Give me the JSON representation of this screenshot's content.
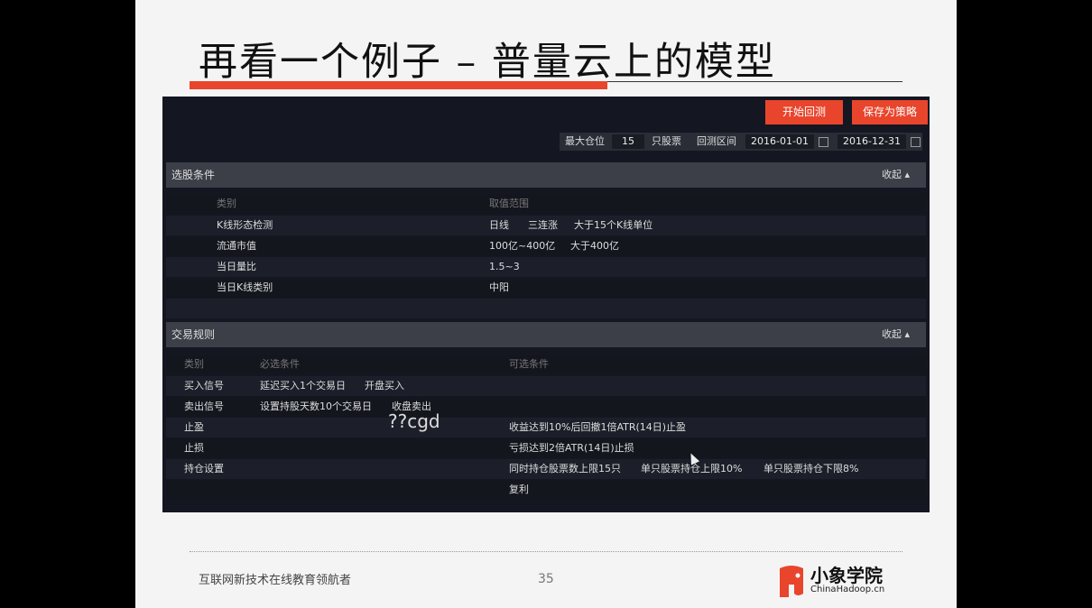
{
  "slide": {
    "title": "再看一个例子 – 普量云上的模型",
    "footer_text": "互联网新技术在线教育领航者",
    "page_number": "35",
    "logo_name": "小象学院",
    "logo_url": "ChinaHadoop.cn"
  },
  "toolbar": {
    "start_backtest": "开始回测",
    "save_strategy": "保存为策略"
  },
  "params": {
    "max_position_label": "最大仓位",
    "max_position_value": "15",
    "max_position_unit": "只股票",
    "period_label": "回测区间",
    "start_date": "2016-01-01",
    "end_date": "2016-12-31"
  },
  "stock_selection": {
    "title": "选股条件",
    "toggle": "收起",
    "headers": [
      "类别",
      "取值范围"
    ],
    "rows": [
      {
        "category": "K线形态检测",
        "values": [
          "日线",
          "三连涨",
          "大于15个K线单位"
        ]
      },
      {
        "category": "流通市值",
        "values": [
          "100亿~400亿",
          "大于400亿"
        ]
      },
      {
        "category": "当日量比",
        "values": [
          "1.5~3"
        ]
      },
      {
        "category": "当日K线类别",
        "values": [
          "中阳"
        ]
      }
    ]
  },
  "trade_rules": {
    "title": "交易规则",
    "toggle": "收起",
    "headers": [
      "类别",
      "必选条件",
      "可选条件"
    ],
    "rows": [
      {
        "category": "买入信号",
        "required": [
          "延迟买入1个交易日",
          "开盘买入"
        ],
        "optional": []
      },
      {
        "category": "卖出信号",
        "required": [
          "设置持股天数10个交易日",
          "收盘卖出"
        ],
        "optional": []
      },
      {
        "category": "止盈",
        "required": [],
        "optional": [
          "收益达到10%后回撤1倍ATR(14日)止盈"
        ]
      },
      {
        "category": "止损",
        "required": [],
        "optional": [
          "亏损达到2倍ATR(14日)止损"
        ]
      },
      {
        "category": "持仓设置",
        "required": [],
        "optional": [
          "同时持仓股票数上限15只",
          "单只股票持仓上限10%",
          "单只股票持仓下限8%"
        ]
      },
      {
        "category": "",
        "required": [],
        "optional": [
          "复利"
        ]
      }
    ]
  },
  "annotation": "??cgd"
}
